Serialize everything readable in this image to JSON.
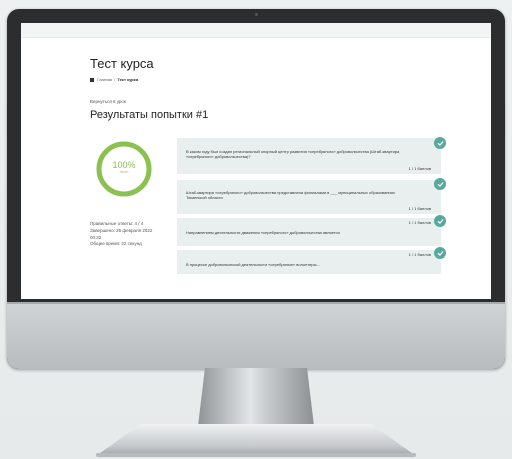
{
  "page": {
    "course_title": "Тест курса",
    "breadcrumb": {
      "home": "Главная",
      "separator": "/",
      "current": "Тест курса"
    },
    "back_link": "Вернуться в урок",
    "results_title": "Результаты попытки #1"
  },
  "result": {
    "percent_text": "100%",
    "status_text": "Зачёт",
    "percent_value": 100,
    "ring_color": "#8cc152",
    "stats": {
      "correct": "Правильные ответы: 4 / 4",
      "completed": "Завершено: 25 февраля 2022",
      "time": "00:32",
      "total_time": "Общее время: 22 секунд"
    }
  },
  "questions": [
    {
      "text": "В каком году был создан региональный опорный центр развития «серебряного» добровольчества (Штаб-квартира «серебряного» добровольчества)?",
      "score": "1 / 1 баллов",
      "status_icon": "check-icon"
    },
    {
      "text": "Штаб-квартира «серебряного» добровольчества представлена филиалами в ___ муниципальных образованиях Тюменской области",
      "score": "1 / 1 баллов",
      "status_icon": "check-icon"
    },
    {
      "text": "Направлением деятельности движения «серебряного» добровольчества является",
      "score": "1 / 1 баллов",
      "status_icon": "check-icon"
    },
    {
      "text": "В процессе добровольческой деятельности «серебряные» волонтеры...",
      "score": "1 / 1 баллов",
      "status_icon": "check-icon"
    }
  ],
  "colors": {
    "accent": "#8cc152",
    "check": "#56a99c",
    "card_bg": "#e8efee",
    "monitor_bezel": "#2b2d2f"
  }
}
